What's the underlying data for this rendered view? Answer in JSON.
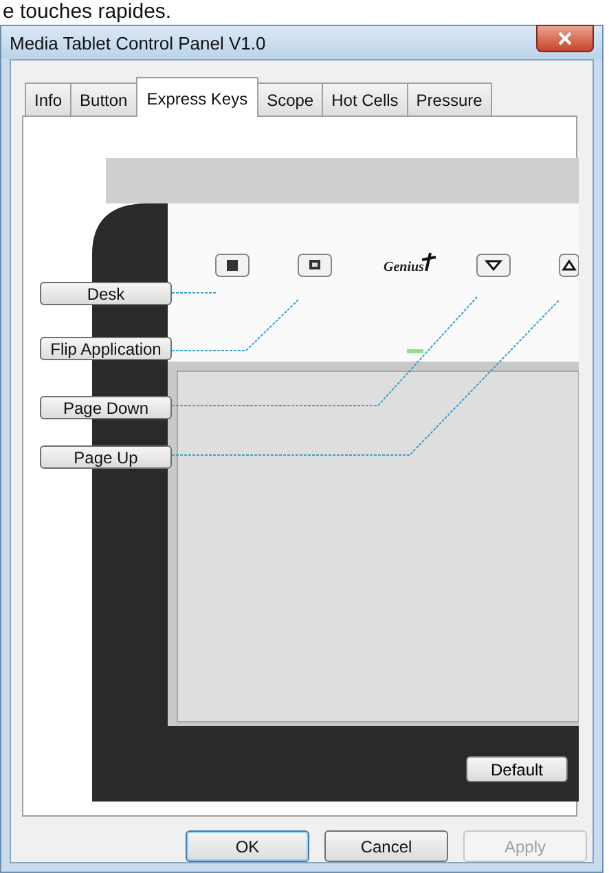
{
  "caption": "e touches rapides.",
  "window": {
    "title": "Media Tablet Control Panel V1.0"
  },
  "tabs": [
    {
      "label": "Info",
      "selected": false
    },
    {
      "label": "Button",
      "selected": false
    },
    {
      "label": "Express Keys",
      "selected": true
    },
    {
      "label": "Scope",
      "selected": false
    },
    {
      "label": "Hot Cells",
      "selected": false
    },
    {
      "label": "Pressure",
      "selected": false
    }
  ],
  "brand": "Genius",
  "key_assignments": [
    {
      "label": "Desk"
    },
    {
      "label": "Flip Application"
    },
    {
      "label": "Page Down"
    },
    {
      "label": "Page Up"
    }
  ],
  "default_button": "Default",
  "buttons": [
    {
      "label": "OK",
      "default": true,
      "disabled": false
    },
    {
      "label": "Cancel",
      "default": false,
      "disabled": false
    },
    {
      "label": "Apply",
      "default": false,
      "disabled": true
    }
  ]
}
